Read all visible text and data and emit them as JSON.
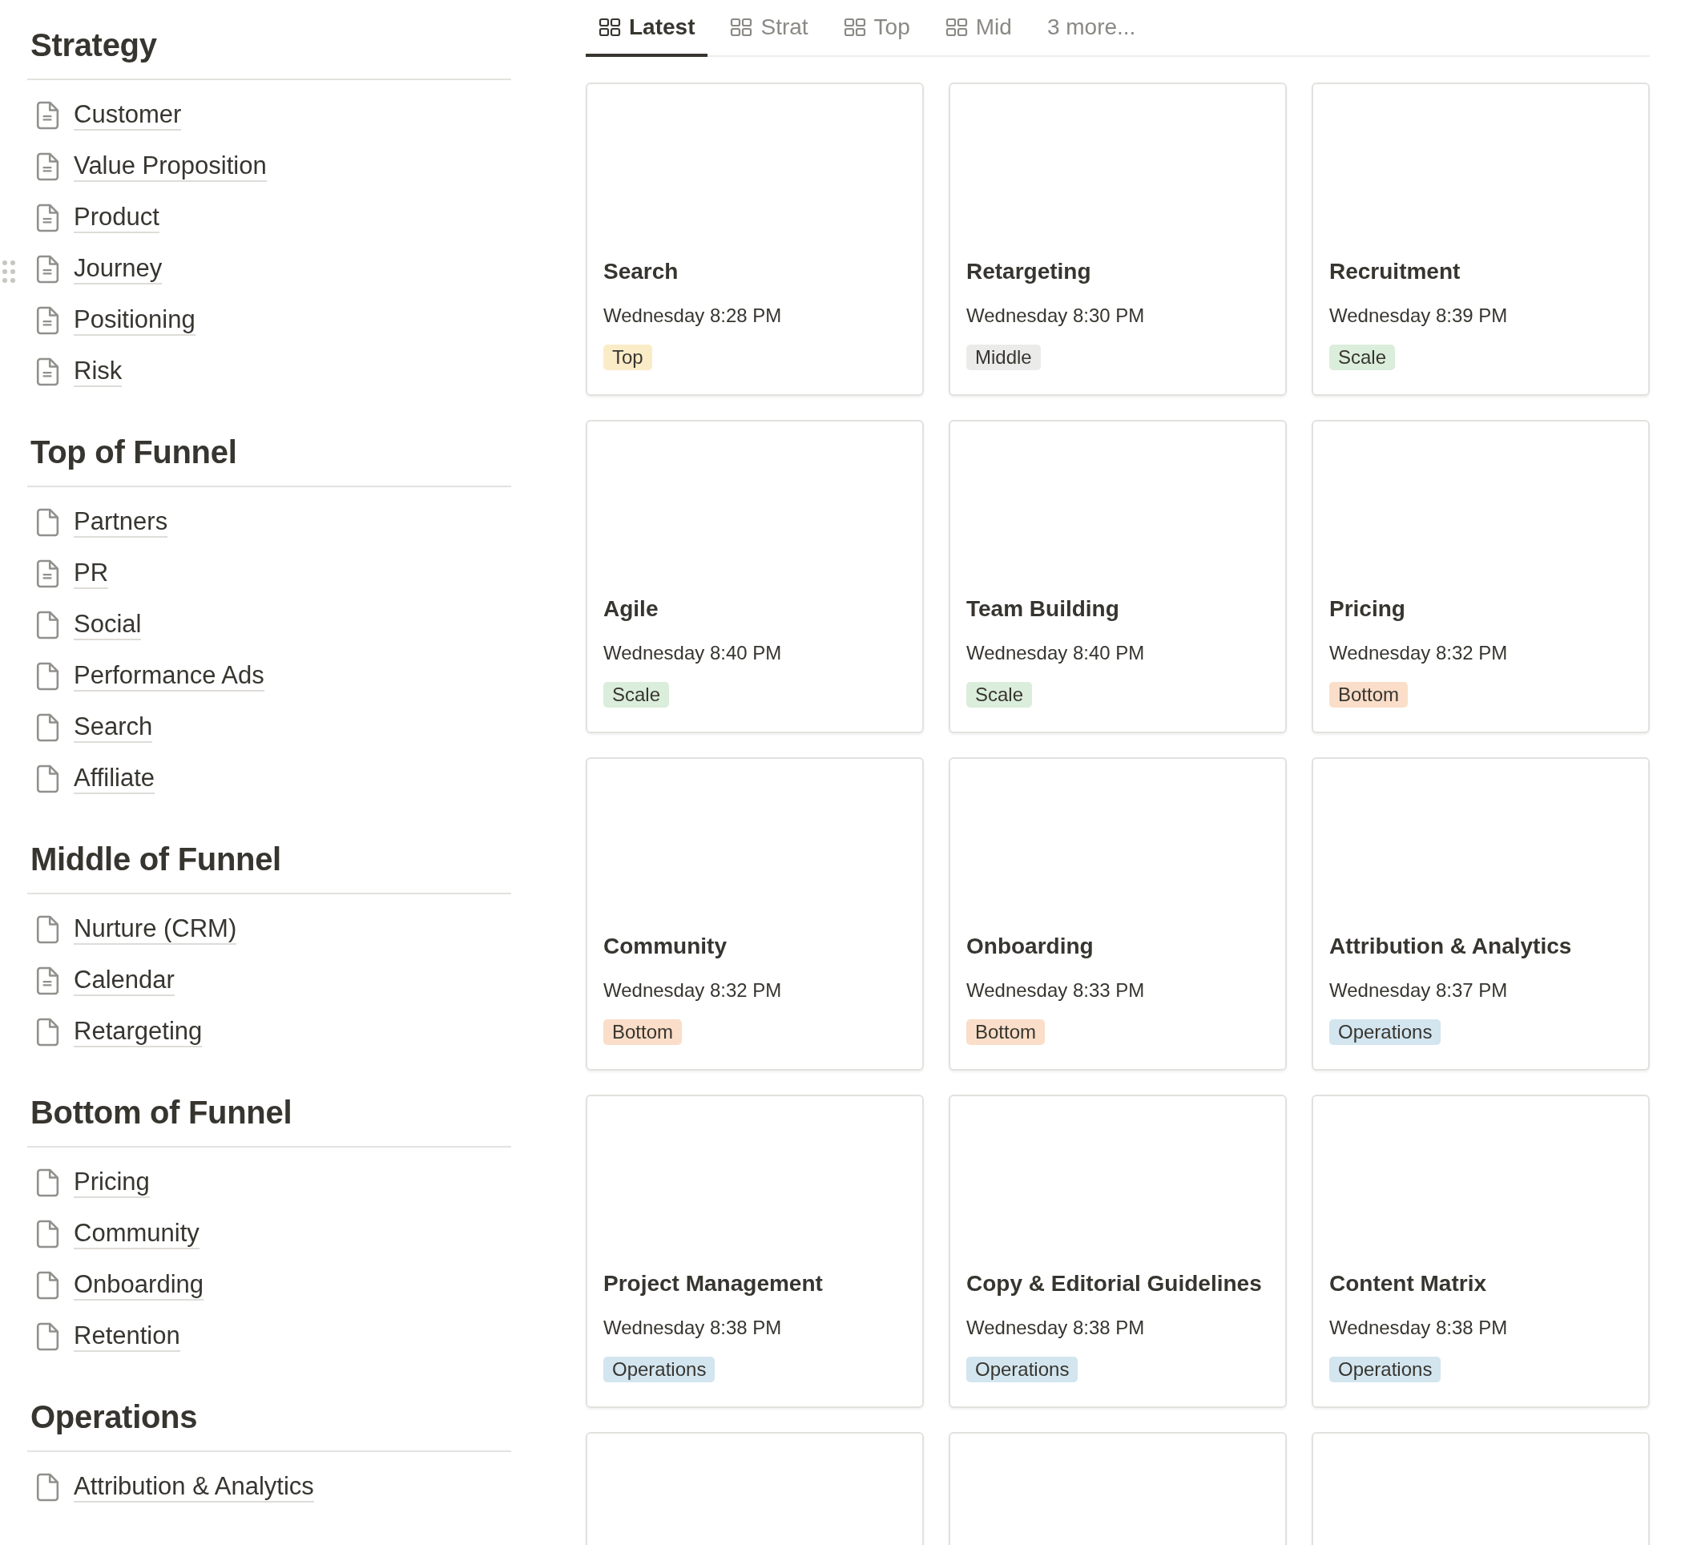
{
  "sidebar": {
    "sections": [
      {
        "title": "Strategy",
        "items": [
          {
            "label": "Customer",
            "kind": "text",
            "hovered": false
          },
          {
            "label": "Value Proposition",
            "kind": "text",
            "hovered": false
          },
          {
            "label": "Product",
            "kind": "text",
            "hovered": false
          },
          {
            "label": "Journey",
            "kind": "text",
            "hovered": true
          },
          {
            "label": "Positioning",
            "kind": "text",
            "hovered": false
          },
          {
            "label": "Risk",
            "kind": "text",
            "hovered": false
          }
        ]
      },
      {
        "title": "Top of Funnel",
        "items": [
          {
            "label": "Partners",
            "kind": "blank",
            "hovered": false
          },
          {
            "label": "PR",
            "kind": "text",
            "hovered": false
          },
          {
            "label": "Social",
            "kind": "blank",
            "hovered": false
          },
          {
            "label": "Performance Ads",
            "kind": "blank",
            "hovered": false
          },
          {
            "label": "Search",
            "kind": "blank",
            "hovered": false
          },
          {
            "label": "Affiliate",
            "kind": "blank",
            "hovered": false
          }
        ]
      },
      {
        "title": "Middle of Funnel",
        "items": [
          {
            "label": "Nurture (CRM)",
            "kind": "blank",
            "hovered": false
          },
          {
            "label": "Calendar",
            "kind": "text",
            "hovered": false
          },
          {
            "label": "Retargeting",
            "kind": "blank",
            "hovered": false
          }
        ]
      },
      {
        "title": "Bottom of Funnel",
        "items": [
          {
            "label": "Pricing",
            "kind": "blank",
            "hovered": false
          },
          {
            "label": "Community",
            "kind": "blank",
            "hovered": false
          },
          {
            "label": "Onboarding",
            "kind": "blank",
            "hovered": false
          },
          {
            "label": "Retention",
            "kind": "blank",
            "hovered": false
          }
        ]
      },
      {
        "title": "Operations",
        "items": [
          {
            "label": "Attribution & Analytics",
            "kind": "blank",
            "hovered": false
          }
        ]
      }
    ]
  },
  "tabs": [
    {
      "label": "Latest",
      "selected": true,
      "kind": "gallery"
    },
    {
      "label": "Strat",
      "selected": false,
      "kind": "gallery"
    },
    {
      "label": "Top",
      "selected": false,
      "kind": "gallery"
    },
    {
      "label": "Mid",
      "selected": false,
      "kind": "gallery"
    },
    {
      "label": "3 more...",
      "selected": false,
      "kind": "more"
    }
  ],
  "cards": [
    {
      "title": "Search",
      "date": "Wednesday 8:28 PM",
      "tag": {
        "label": "Top",
        "color": "#fbecc8"
      }
    },
    {
      "title": "Retargeting",
      "date": "Wednesday 8:30 PM",
      "tag": {
        "label": "Middle",
        "color": "#ebebea"
      }
    },
    {
      "title": "Recruitment",
      "date": "Wednesday 8:39 PM",
      "tag": {
        "label": "Scale",
        "color": "#dbeddb"
      }
    },
    {
      "title": "Agile",
      "date": "Wednesday 8:40 PM",
      "tag": {
        "label": "Scale",
        "color": "#dbeddb"
      }
    },
    {
      "title": "Team Building",
      "date": "Wednesday 8:40 PM",
      "tag": {
        "label": "Scale",
        "color": "#dbeddb"
      }
    },
    {
      "title": "Pricing",
      "date": "Wednesday 8:32 PM",
      "tag": {
        "label": "Bottom",
        "color": "#fadec9"
      }
    },
    {
      "title": "Community",
      "date": "Wednesday 8:32 PM",
      "tag": {
        "label": "Bottom",
        "color": "#fadec9"
      }
    },
    {
      "title": "Onboarding",
      "date": "Wednesday 8:33 PM",
      "tag": {
        "label": "Bottom",
        "color": "#fadec9"
      }
    },
    {
      "title": "Attribution & Analytics",
      "date": "Wednesday 8:37 PM",
      "tag": {
        "label": "Operations",
        "color": "#d3e5ef"
      }
    },
    {
      "title": "Project Management",
      "date": "Wednesday 8:38 PM",
      "tag": {
        "label": "Operations",
        "color": "#d3e5ef"
      }
    },
    {
      "title": "Copy & Editorial Guidelines",
      "date": "Wednesday 8:38 PM",
      "tag": {
        "label": "Operations",
        "color": "#d3e5ef"
      }
    },
    {
      "title": "Content Matrix",
      "date": "Wednesday 8:38 PM",
      "tag": {
        "label": "Operations",
        "color": "#d3e5ef"
      }
    },
    {
      "kind": "empty"
    },
    {
      "kind": "empty"
    },
    {
      "kind": "empty"
    }
  ]
}
